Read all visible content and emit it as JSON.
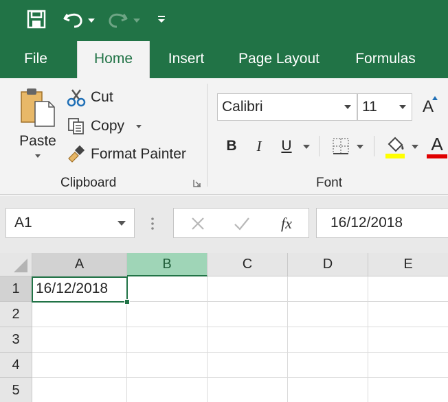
{
  "tabs": {
    "file": "File",
    "home": "Home",
    "insert": "Insert",
    "page_layout": "Page Layout",
    "formulas": "Formulas"
  },
  "clipboard": {
    "paste": "Paste",
    "cut": "Cut",
    "copy": "Copy",
    "format_painter": "Format Painter",
    "group_label": "Clipboard"
  },
  "font": {
    "name": "Calibri",
    "size": "11",
    "grow_label": "A",
    "bold": "B",
    "italic": "I",
    "underline": "U",
    "font_color_label": "A",
    "group_label": "Font"
  },
  "formula_bar": {
    "name_box": "A1",
    "fx": "fx",
    "formula": "16/12/2018"
  },
  "grid": {
    "columns": [
      "A",
      "B",
      "C",
      "D",
      "E"
    ],
    "rows": [
      "1",
      "2",
      "3",
      "4",
      "5"
    ],
    "cells": {
      "A1": "16/12/2018"
    }
  },
  "colors": {
    "accent": "#217346",
    "fill_color": "#ffff00",
    "font_color": "#e00000",
    "highlight_column_header": "#9fd5b7"
  }
}
